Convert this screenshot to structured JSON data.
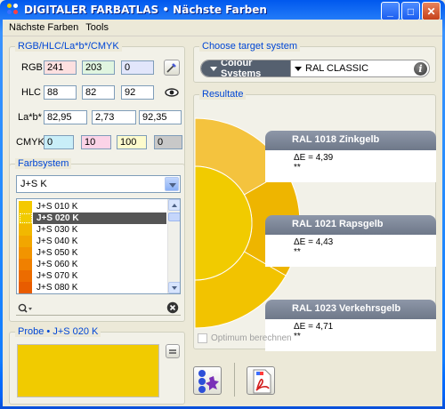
{
  "window": {
    "title": "DIGITALER FARBATLAS • Nächste Farben"
  },
  "menu": {
    "items": [
      "Nächste Farben",
      "Tools"
    ]
  },
  "color_values": {
    "panel_title": "RGB/HLC/La*b*/CMYK",
    "rgb": {
      "label": "RGB",
      "r": "241",
      "g": "203",
      "b": "0"
    },
    "hlc": {
      "label": "HLC",
      "h": "88",
      "l": "82",
      "c": "92"
    },
    "lab": {
      "label": "La*b*",
      "l": "82,95",
      "a": "2,73",
      "b": "92,35"
    },
    "cmyk": {
      "label": "CMYK",
      "c": "0",
      "m": "10",
      "y": "100",
      "k": "0"
    }
  },
  "farbsystem": {
    "panel_title": "Farbsystem",
    "selected_system": "J+S K",
    "items": [
      {
        "label": "J+S 010 K",
        "color": "#f4c900"
      },
      {
        "label": "J+S 020 K",
        "color": "#f1cb00",
        "selected": true
      },
      {
        "label": "J+S 030 K",
        "color": "#f2b800"
      },
      {
        "label": "J+S 040 K",
        "color": "#f2a600"
      },
      {
        "label": "J+S 050 K",
        "color": "#f29400"
      },
      {
        "label": "J+S 060 K",
        "color": "#f08000"
      },
      {
        "label": "J+S 070 K",
        "color": "#ec6c00"
      },
      {
        "label": "J+S 080 K",
        "color": "#e85c00"
      }
    ],
    "search_placeholder": ""
  },
  "probe": {
    "panel_title": "Probe • J+S 020 K",
    "color": "#f1cb00"
  },
  "target": {
    "panel_title": "Choose target system",
    "system_type": "Colour Systems",
    "system_name": "RAL CLASSIC"
  },
  "results": {
    "panel_title": "Resultate",
    "items": [
      {
        "name": "RAL 1018 Zinkgelb",
        "delta": "ΔE = 4,39",
        "stars": "**",
        "color": "#f4c33e"
      },
      {
        "name": "RAL 1021 Rapsgelb",
        "delta": "ΔE = 4,43",
        "stars": "**",
        "color": "#eeb500"
      },
      {
        "name": "RAL 1023 Verkehrsgelb",
        "delta": "ΔE = 4,71",
        "stars": "**",
        "color": "#f2c300"
      }
    ],
    "center_color": "#f1cb00",
    "optimum_label": "Optimum berechnen"
  }
}
